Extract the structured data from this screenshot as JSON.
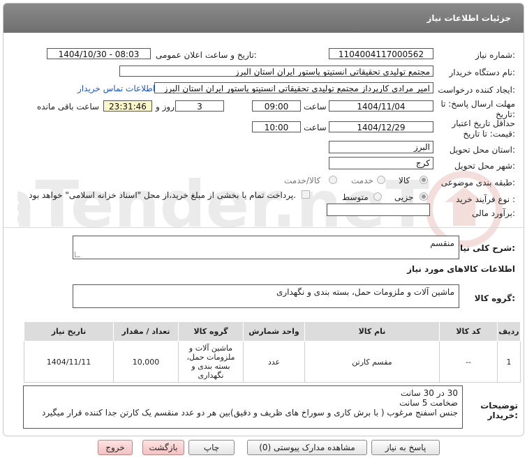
{
  "header": {
    "title": "جزئیات اطلاعات نیاز"
  },
  "watermark": {
    "text": "AriaTender.neT"
  },
  "fields": {
    "need_number_label": "شماره نیاز:",
    "need_number": "1104004117000562",
    "announce_label": "تاریخ و ساعت اعلان عمومی:",
    "announce_value": "1404/10/30 - 08:03",
    "buyer_label": "نام دستگاه خریدار:",
    "buyer_value": "مجتمع تولیدی تحقیقاتی انستیتو پاستور ایران استان البرز",
    "creator_label": "ایجاد کننده درخواست:",
    "creator_value": "امیر مرادی کارپرداز مجتمع تولیدی تحقیقاتی انستیتو پاستور ایران استان البرز",
    "contact_link": "اطلاعات تماس خریدار",
    "deadline_label_1": "مهلت ارسال پاسخ: تا",
    "deadline_label_2": "تاریخ:",
    "deadline_date": "1404/11/04",
    "time_label": "ساعت",
    "deadline_time": "09:00",
    "days_value": "3",
    "days_label": "روز و",
    "remaining_time": "23:31:46",
    "remaining_label": "ساعت باقی مانده",
    "validity_label_1": "حداقل تاریخ اعتبار",
    "validity_label_2": "قیمت: تا تاریخ:",
    "validity_date": "1404/12/29",
    "validity_time_label": "ساعت",
    "validity_time": "10:00",
    "province_label": "استان محل تحویل:",
    "province_value": "البرز",
    "city_label": "شهر محل تحویل:",
    "city_value": "کرج",
    "category_label": "طبقه بندی موضوعی:",
    "category_options": [
      "کالا",
      "خدمت",
      "کالا/خدمت"
    ],
    "category_selected": "کالا",
    "process_label": "نوع فرآیند خرید :",
    "process_options": [
      "جزیی",
      "متوسط"
    ],
    "process_selected": "جزیی",
    "payment_note": "پرداخت تمام یا بخشی از مبلغ خرید،از محل \"اسناد خزانه اسلامی\" خواهد بود.",
    "estimate_label": "برآورد مالی:",
    "estimate_value": ""
  },
  "summary": {
    "label": "شرح کلی نیاز:",
    "value": "منقسم"
  },
  "goods": {
    "section_title": "اطلاعات کالاهای مورد نیاز",
    "group_label": "گروه کالا:",
    "group_value": "ماشین آلات و ملزومات حمل، بسته بندی و نگهداری",
    "columns": [
      "ردیف",
      "کد کالا",
      "نام کالا",
      "واحد شمارش",
      "گروه کالا",
      "تعداد / مقدار",
      "تاریخ نیاز"
    ],
    "rows": [
      {
        "index": "1",
        "code": "--",
        "name": "مقسم کارتن",
        "unit": "عدد",
        "group": "ماشین آلات و ملزومات حمل، بسته بندی و نگهداری",
        "quantity": "10,000",
        "date": "1404/11/11"
      }
    ]
  },
  "buyer_notes": {
    "label_1": "توضیحات",
    "label_2": "خریدار:",
    "lines": [
      "30 در 30 سانت",
      "ضخامت 5 سانت",
      "جنس اسفنج مرغوب ( با برش کاری و سوراخ های ظریف و دقیق)بین هر دو عدد منقسم یک کارتن جدا کننده قرار میگیرد"
    ]
  },
  "buttons": {
    "reply": "پاسخ به نیاز",
    "attachments": "مشاهده مدارک پیوستی (0)",
    "print": "چاپ",
    "back": "بازگشت",
    "exit": "خروج"
  },
  "colors": {
    "header_bg": "#7d7d7d",
    "link": "#1a56c8",
    "remaining_bg": "#fbf7c8",
    "pink_button": "#f3c2c2"
  }
}
